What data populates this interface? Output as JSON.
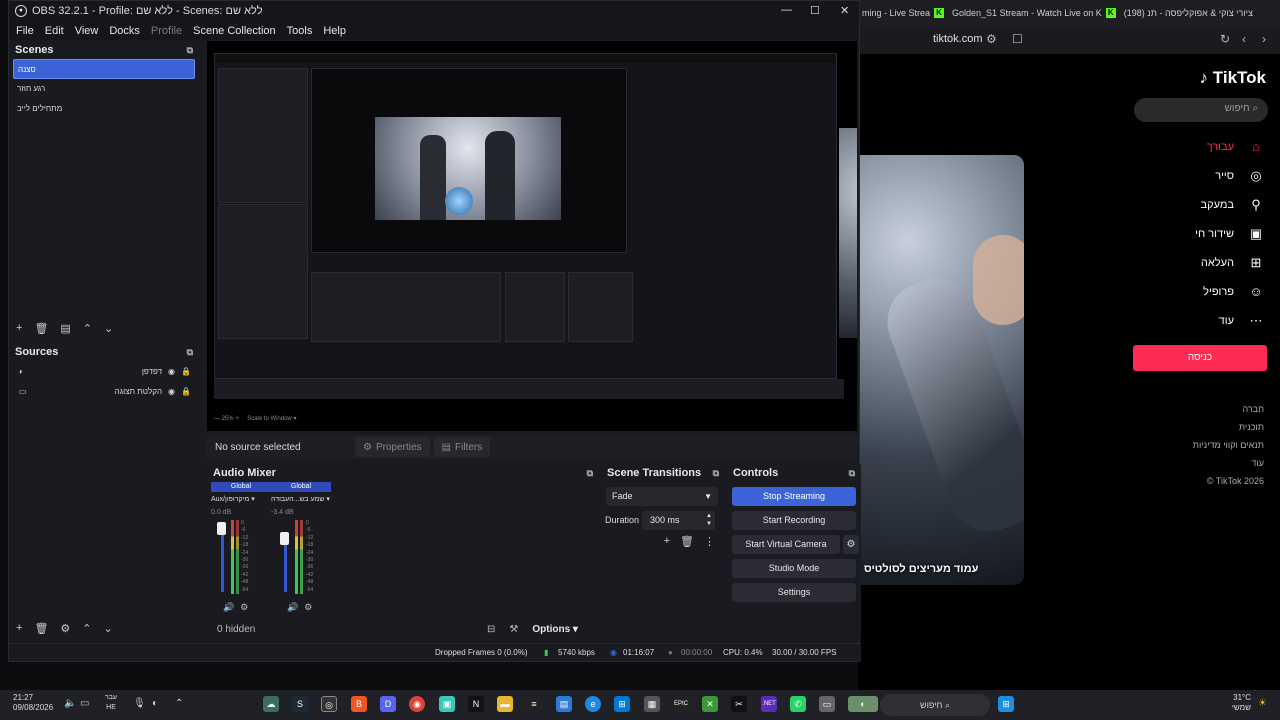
{
  "window": {
    "title": "OBS 32.2.1 - Profile: ללא שם - Scenes: ללא שם"
  },
  "menu": [
    "File",
    "Edit",
    "View",
    "Docks",
    "Profile",
    "Scene Collection",
    "Tools",
    "Help"
  ],
  "scenes": {
    "title": "Scenes",
    "items": [
      {
        "label": "סצנה",
        "selected": true
      },
      {
        "label": "רגע חוזר",
        "selected": false
      },
      {
        "label": "מתחילים לייב",
        "selected": false
      }
    ]
  },
  "sources": {
    "title": "Sources",
    "items": [
      {
        "label": "דפדפן",
        "icon": "browser-icon"
      },
      {
        "label": "הקלטת תצוגה",
        "icon": "monitor-icon"
      }
    ]
  },
  "context": {
    "no_source": "No source selected",
    "properties": "Properties",
    "filters": "Filters"
  },
  "mixer": {
    "title": "Audio Mixer",
    "channels": [
      {
        "global": "Global",
        "name": "Aux/מיקרופון",
        "db": "0.0 dB"
      },
      {
        "global": "Global",
        "name": "שמע בש...העבודה",
        "db": "-3.4 dB"
      }
    ],
    "scale": [
      "0",
      "-6",
      "-12",
      "-18",
      "-24",
      "-30",
      "-36",
      "-42",
      "-48",
      "-54",
      "-60"
    ],
    "hidden": "0 hidden",
    "options": "Options"
  },
  "transitions": {
    "title": "Scene Transitions",
    "type": "Fade",
    "duration_label": "Duration",
    "duration": "300 ms"
  },
  "controls": {
    "title": "Controls",
    "stop_streaming": "Stop Streaming",
    "start_recording": "Start Recording",
    "start_virtual_camera": "Start Virtual Camera",
    "studio_mode": "Studio Mode",
    "settings": "Settings"
  },
  "status": {
    "dropped": "Dropped Frames 0 (0.0%)",
    "bitrate": "5740 kbps",
    "stream_time": "01:16:07",
    "rec_time": "00:00:00",
    "cpu": "CPU: 0.4%",
    "fps": "30.00 / 30.00 FPS"
  },
  "browser": {
    "tabs": [
      "ming - Live Strea",
      "Golden_S1 Stream - Watch Live on K",
      "(198) ציורי צוקי & אפוקליפסה - תנ"
    ],
    "url": "tiktok.com",
    "logo": "TikTok",
    "search_placeholder": "חיפוש",
    "nav": [
      {
        "label": "עבורך",
        "icon": "home-icon",
        "active": true
      },
      {
        "label": "סייר",
        "icon": "compass-icon",
        "active": false
      },
      {
        "label": "במעקב",
        "icon": "following-icon",
        "active": false
      },
      {
        "label": "שידור חי",
        "icon": "live-icon",
        "active": false
      },
      {
        "label": "העלאה",
        "icon": "upload-icon",
        "active": false
      },
      {
        "label": "פרופיל",
        "icon": "profile-icon",
        "active": false
      },
      {
        "label": "עוד",
        "icon": "more-icon",
        "active": false
      }
    ],
    "login": "כניסה",
    "links": [
      "חברה",
      "תוכנית",
      "תנאים וקווי מדיניות",
      "עוד"
    ],
    "copyright": "© TikTok 2026",
    "video_caption": "עמוד מעריצים לסולטיס"
  },
  "preview": {
    "zoom": "25%",
    "scale_mode": "Scale to Window"
  },
  "taskbar": {
    "time": "21:27",
    "date": "09/08/2026",
    "lang1": "עבר",
    "lang2": "HE",
    "search": "חיפוש",
    "weather_temp": "31°C",
    "weather_desc": "שמשי"
  },
  "colors": {
    "accent": "#3c64d8",
    "tiktok_red": "#fe2c55",
    "panel": "#1a1b20"
  }
}
